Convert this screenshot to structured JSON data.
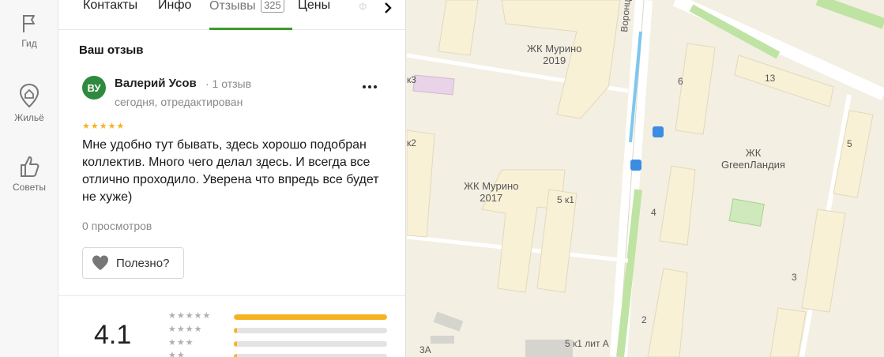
{
  "sidebar": {
    "items": [
      {
        "label": "Гид",
        "icon": "flag-icon"
      },
      {
        "label": "Жильё",
        "icon": "house-pin-icon"
      },
      {
        "label": "Советы",
        "icon": "thumbs-up-icon"
      }
    ]
  },
  "tabs": [
    {
      "label": "Контакты"
    },
    {
      "label": "Инфо"
    },
    {
      "label": "Отзывы",
      "count": "325",
      "active": true
    },
    {
      "label": "Цены"
    },
    {
      "label": "Ф"
    }
  ],
  "review": {
    "section_title": "Ваш отзыв",
    "avatar_initials": "ВУ",
    "author": "Валерий Усов",
    "author_meta": "· 1 отзыв",
    "date": "сегодня, отредактирован",
    "stars": 5,
    "stars_text": "★★★★★",
    "text": "Мне удобно тут бывать, здесь хорошо подобран коллектив. Много чего делал здесь. И всегда все отлично проходило. Уверена что впредь все будет не хуже)",
    "views": "0 просмотров",
    "useful_label": "Полезно?"
  },
  "summary": {
    "rating": "4.1",
    "distribution": [
      {
        "stars": "★★★★★",
        "fraction": 1.0
      },
      {
        "stars": "★★★★",
        "fraction": 0.02
      },
      {
        "stars": "★★★",
        "fraction": 0.02
      },
      {
        "stars": "★★",
        "fraction": 0.02
      }
    ]
  },
  "map": {
    "labels": [
      {
        "text": "ЖК Мурино\n2019"
      },
      {
        "text": "ЖК Мурино\n2017"
      },
      {
        "text": "ЖК\nGreenЛандия"
      }
    ],
    "street": "Воронцовский б-р",
    "numbers": [
      "6",
      "13",
      "5",
      "4",
      "3",
      "2",
      "5 к1",
      "5 к1 лит А",
      "3А",
      "к2",
      "к3"
    ]
  },
  "colors": {
    "accent_green": "#3e9a2b",
    "star_yellow": "#f5b324",
    "avatar_green": "#2f8a3f"
  }
}
